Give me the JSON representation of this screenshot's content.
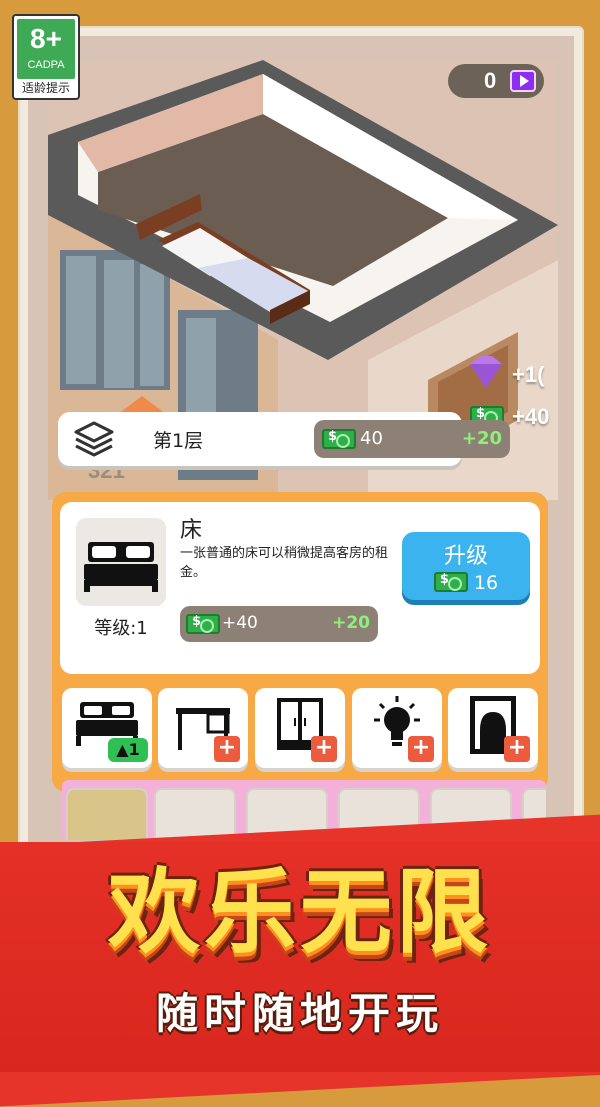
{
  "age_rating": {
    "badge": "8+",
    "org": "CADPA",
    "caption": "适龄提示"
  },
  "currency": {
    "diamonds": "0"
  },
  "scene": {
    "float_gem_value": "+1(",
    "float_cash_value": "+40"
  },
  "floor": {
    "label": "第1层",
    "income": "40",
    "bonus": "+20",
    "ghost_value": "321"
  },
  "item": {
    "name": "床",
    "description": "一张普通的床可以稍微提高客房的租金。",
    "level": "等级:1",
    "income": "+40",
    "bonus": "+20",
    "upgrade_label": "升级",
    "upgrade_cost": "16"
  },
  "furniture": [
    {
      "id": "bed",
      "badge": "1",
      "badge_type": "level"
    },
    {
      "id": "desk",
      "badge": "+",
      "badge_type": "add"
    },
    {
      "id": "wardrobe",
      "badge": "+",
      "badge_type": "add"
    },
    {
      "id": "lamp",
      "badge": "+",
      "badge_type": "add"
    },
    {
      "id": "mirror",
      "badge": "+",
      "badge_type": "add"
    }
  ],
  "banner": {
    "headline": "欢乐无限",
    "subline": "随时随地开玩"
  },
  "colors": {
    "accent_orange": "#f7a945",
    "upgrade_blue": "#3bb3ef",
    "banner_red": "#e43026",
    "title_yellow": "#ffe14d"
  }
}
